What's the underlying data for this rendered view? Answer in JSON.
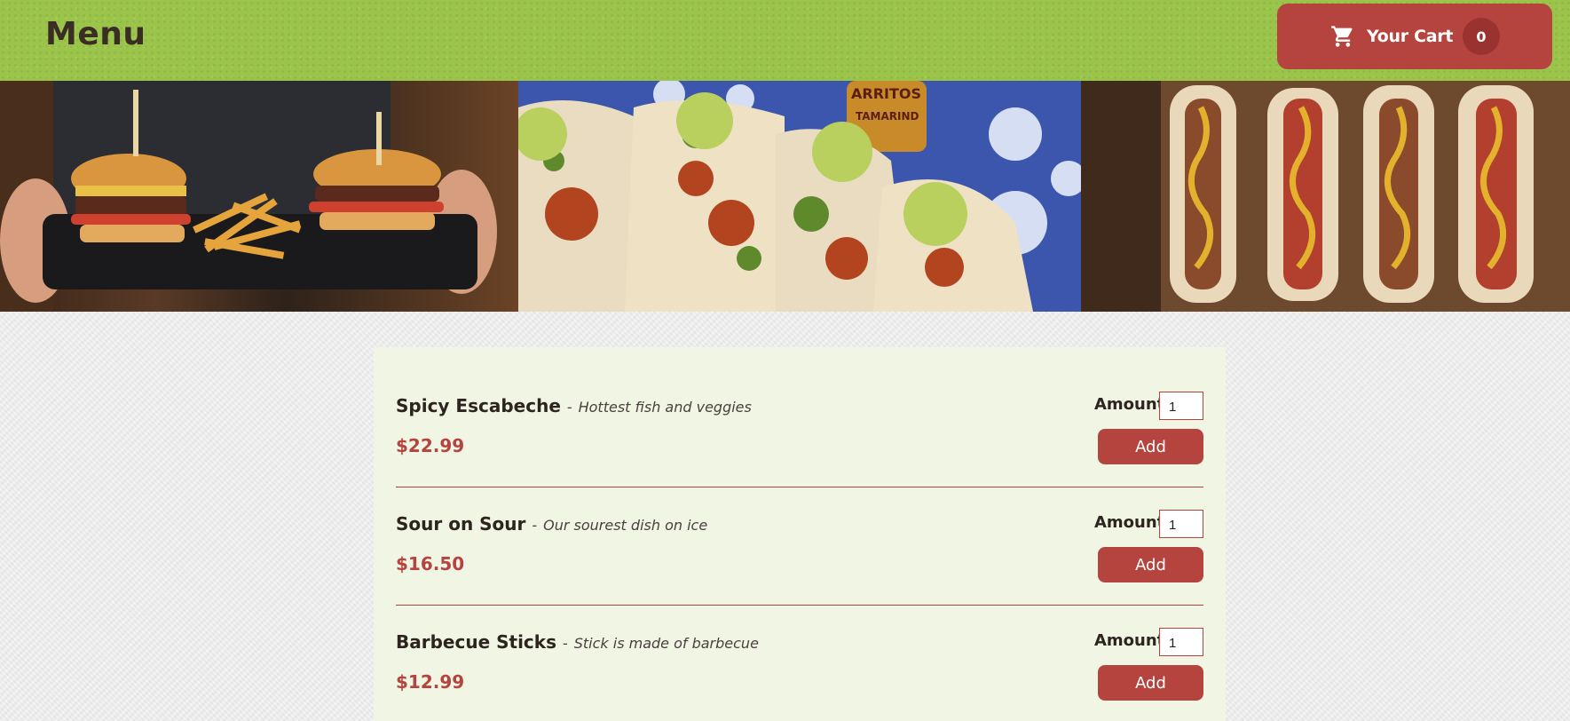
{
  "header": {
    "title": "Menu",
    "cart": {
      "label": "Your Cart",
      "count": "0",
      "icon": "cart-icon"
    }
  },
  "banner": {
    "images": [
      {
        "name": "burgers-and-fries-photo"
      },
      {
        "name": "tacos-photo",
        "visible_text": "ARRITOS TAMARIND"
      },
      {
        "name": "hot-dogs-photo"
      }
    ]
  },
  "menu": {
    "items": [
      {
        "name": "Spicy Escabeche",
        "dash": "-",
        "description": "Hottest fish and veggies",
        "price": "$22.99",
        "amount_label": "Amount",
        "amount": "1",
        "add_label": "Add"
      },
      {
        "name": "Sour on Sour",
        "dash": "-",
        "description": "Our sourest dish on ice",
        "price": "$16.50",
        "amount_label": "Amount",
        "amount": "1",
        "add_label": "Add"
      },
      {
        "name": "Barbecue Sticks",
        "dash": "-",
        "description": "Stick is made of barbecue",
        "price": "$12.99",
        "amount_label": "Amount",
        "amount": "1",
        "add_label": "Add"
      }
    ]
  },
  "colors": {
    "header_bg": "#9bc54a",
    "accent": "#b5443f",
    "card_bg": "#f1f5e4",
    "page_bg": "#ececec",
    "text_dark": "#2d2420"
  }
}
